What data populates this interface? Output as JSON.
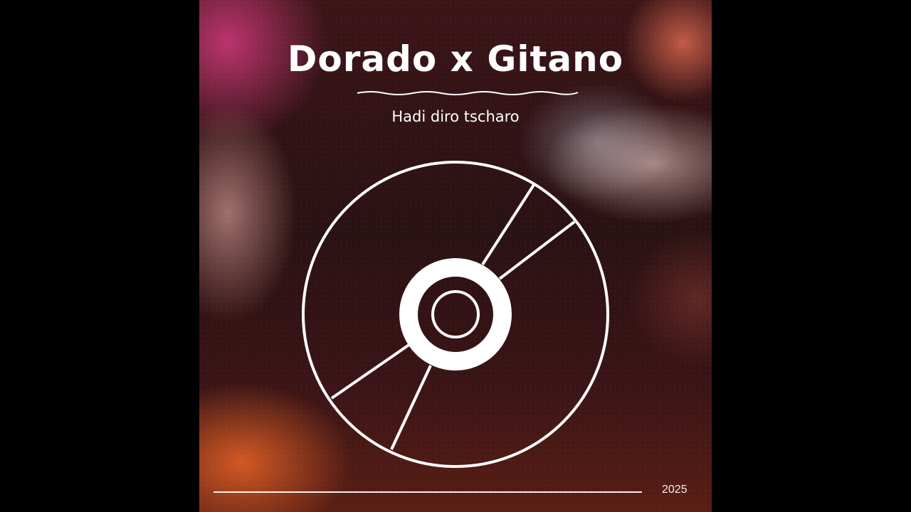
{
  "album": {
    "title": "Dorado x Gitano",
    "subtitle": "Hadi diro tscharo",
    "year": "2025"
  },
  "icons": {
    "disc": "disc-icon"
  },
  "colors": {
    "text": "#ffffff",
    "background": "#000000"
  }
}
